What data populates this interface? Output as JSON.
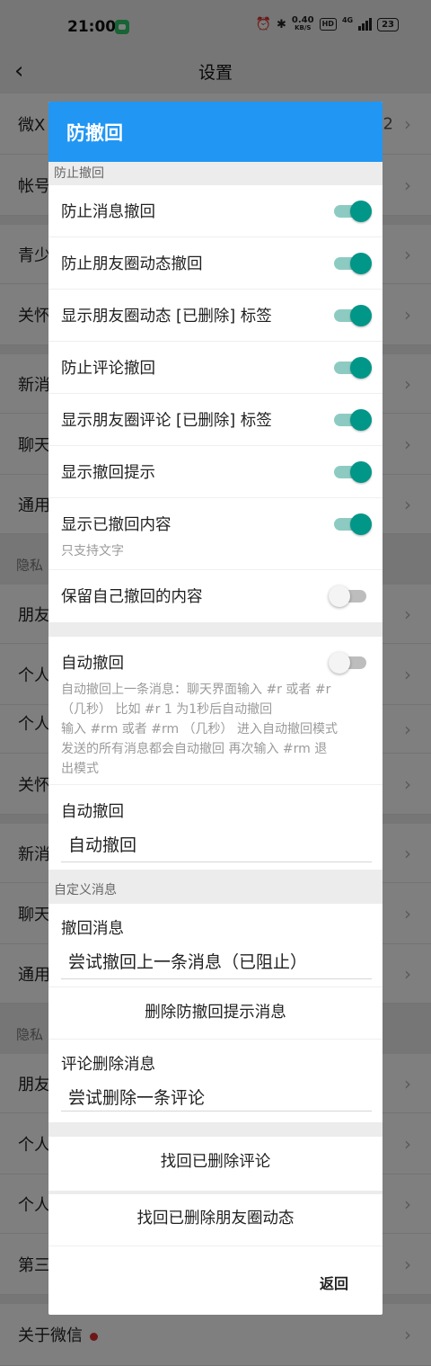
{
  "status_bar": {
    "time": "21:00",
    "speed_value": "0.40",
    "speed_unit": "KB/S",
    "hd": "HD",
    "network": "4G",
    "battery": "23"
  },
  "header": {
    "back_icon": "chevron-left-icon",
    "title": "设置"
  },
  "background_list": {
    "items": [
      {
        "label": "微X",
        "extra": "2"
      },
      {
        "label": "帐号"
      },
      {
        "label": "青少"
      },
      {
        "label": "关怀"
      },
      {
        "label": "新消"
      },
      {
        "label": "聊天"
      },
      {
        "label": "通用"
      },
      {
        "section": "隐私"
      },
      {
        "label": "朋友"
      },
      {
        "label": "个人"
      },
      {
        "label": "个人"
      },
      {
        "label": "关怀"
      },
      {
        "label": "新消"
      },
      {
        "label": "聊天"
      },
      {
        "label": "通用"
      },
      {
        "section": "隐私"
      },
      {
        "label": "朋友"
      },
      {
        "label": "个人"
      },
      {
        "label": "个人"
      },
      {
        "label": "第三"
      },
      {
        "label": "关于微信"
      }
    ]
  },
  "dialog": {
    "title": "防撤回",
    "section_prevent": "防止撤回",
    "toggles": [
      {
        "label": "防止消息撤回",
        "on": true
      },
      {
        "label": "防止朋友圈动态撤回",
        "on": true
      },
      {
        "label": "显示朋友圈动态 [已删除] 标签",
        "on": true
      },
      {
        "label": "防止评论撤回",
        "on": true
      },
      {
        "label": "显示朋友圈评论 [已删除] 标签",
        "on": true
      },
      {
        "label": "显示撤回提示",
        "on": true
      },
      {
        "label": "显示已撤回内容",
        "sub": "只支持文字",
        "on": true
      },
      {
        "label": "保留自己撤回的内容",
        "on": false
      }
    ],
    "auto_recall": {
      "label": "自动撤回",
      "on": false,
      "desc_lines": [
        "自动撤回上一条消息：聊天界面输入 #r 或者 #r",
        "（几秒） 比如 #r 1 为1秒后自动撤回",
        "输入 #rm 或者 #rm （几秒） 进入自动撤回模式",
        "发送的所有消息都会自动撤回 再次输入 #rm 退",
        "出模式"
      ]
    },
    "auto_recall_field": {
      "label": "自动撤回",
      "value": "自动撤回"
    },
    "section_custom": "自定义消息",
    "recall_message": {
      "label": "撤回消息",
      "value": "尝试撤回上一条消息（已阻止）"
    },
    "delete_tip_button": "删除防撤回提示消息",
    "comment_delete": {
      "label": "评论删除消息",
      "value": "尝试删除一条评论"
    },
    "recover_comments_button": "找回已删除评论",
    "recover_moments_button": "找回已删除朋友圈动态",
    "back_button": "返回"
  }
}
